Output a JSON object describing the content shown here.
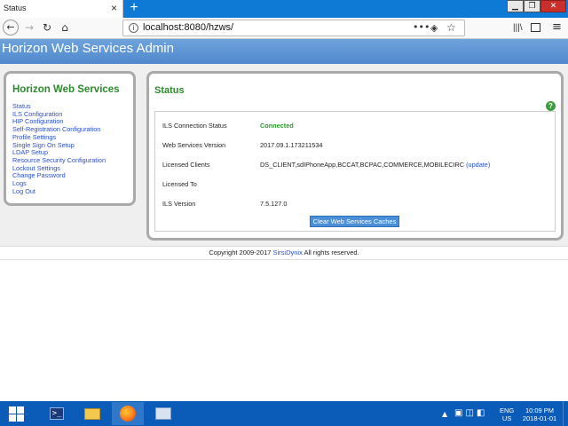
{
  "browser": {
    "tab_title": "Status",
    "tab_close": "×",
    "new_tab": "+",
    "url": "localhost:8080/hzws/",
    "url_more": "•••",
    "window_controls": {
      "minimize": "▁",
      "maximize": "❐",
      "close": "✕"
    }
  },
  "page": {
    "header_title": "Horizon Web Services Admin",
    "nav_title": "Horizon Web Services",
    "nav_links": [
      "Status",
      "ILS Configuration",
      "HIP Configuration",
      "Self-Registration Configuration",
      "Profile Settings",
      "Single Sign On Setup",
      "LDAP Setup",
      "Resource Security Configuration",
      "Lockout Settings",
      "Change Password",
      "Logs",
      "Log Out"
    ],
    "status_title": "Status",
    "rows": [
      {
        "label": "ILS Connection Status",
        "value": "Connected"
      },
      {
        "label": "Web Services Version",
        "value": "2017.09.1.173211534"
      },
      {
        "label": "Licensed Clients",
        "value": "DS_CLIENT,sdIPhoneApp,BCCAT,BCPAC,COMMERCE,MOBILECIRC",
        "link": "(update)"
      },
      {
        "label": "Licensed To",
        "value": ""
      },
      {
        "label": "ILS Version",
        "value": "7.5.127.0"
      }
    ],
    "clear_button": "Clear Web Services Caches",
    "footer_prefix": "Copyright 2009-2017 ",
    "footer_link": "SirsiDynix",
    "footer_suffix": " All rights reserved."
  },
  "taskbar": {
    "lang": "ENG",
    "region": "US",
    "time": "10:09 PM",
    "date": "2018-01-01"
  },
  "colors": {
    "header_blue": "#5a93d4",
    "title_green": "#2c8a2c",
    "link_blue": "#2a4fd0",
    "taskbar_blue": "#0b5bb8"
  }
}
